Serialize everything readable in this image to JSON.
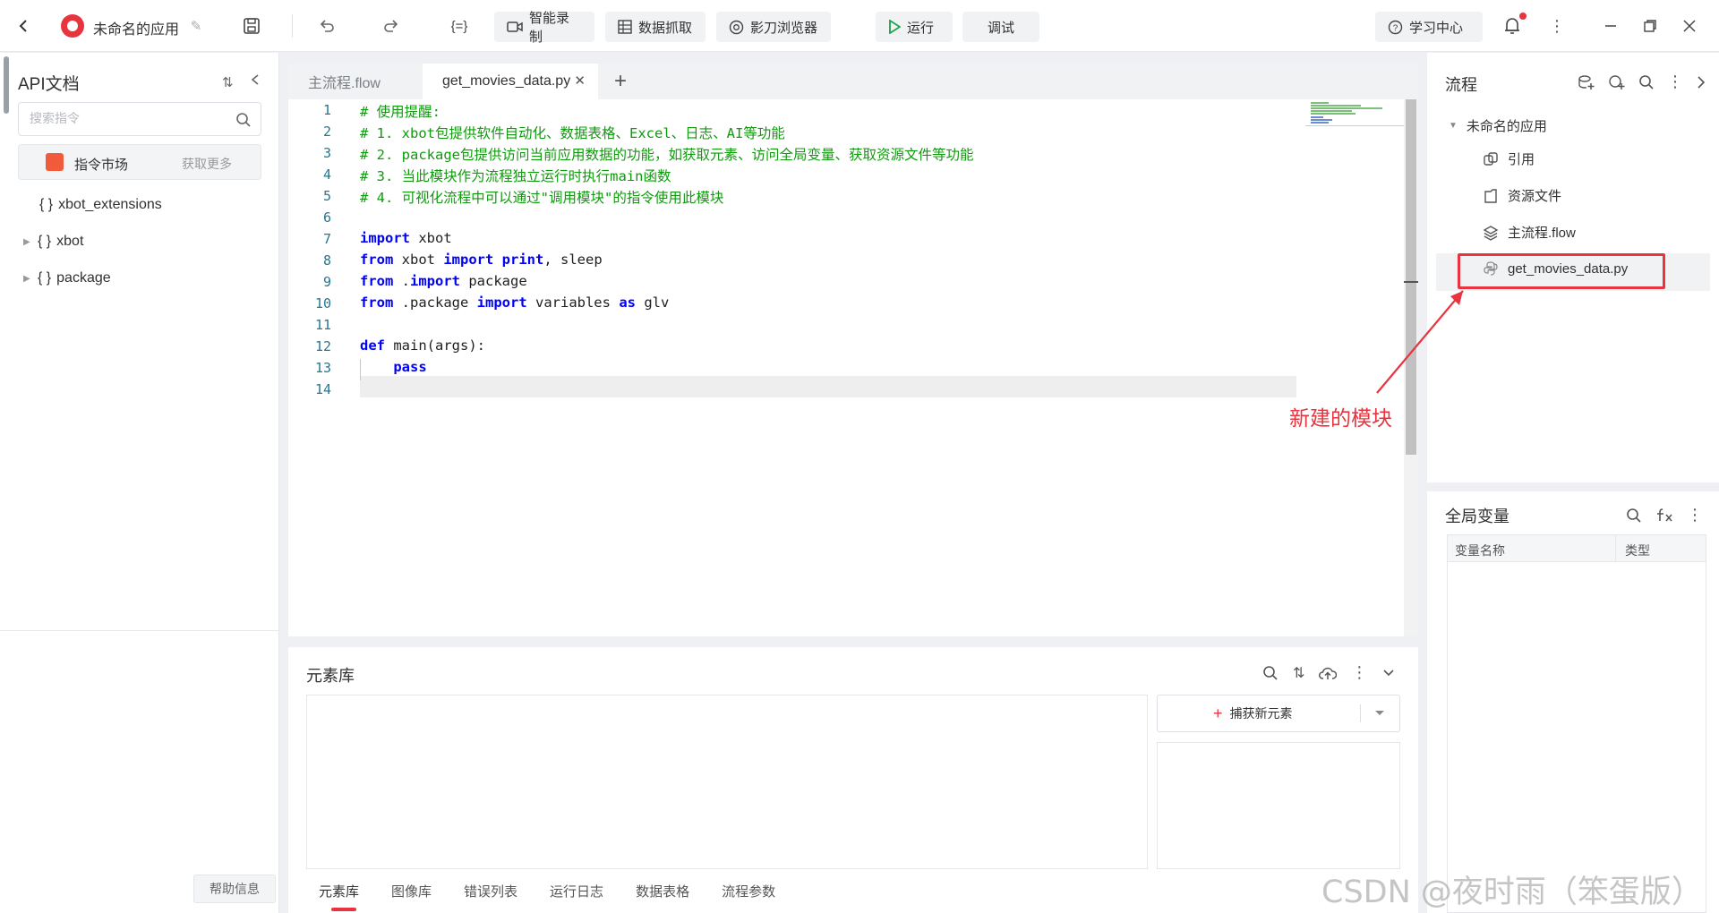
{
  "topbar": {
    "app_title": "未命名的应用",
    "braces_label": "{=}",
    "buttons": {
      "record": "智能录制",
      "scrape": "数据抓取",
      "browser": "影刀浏览器",
      "run": "运行",
      "debug": "调试",
      "learn": "学习中心"
    }
  },
  "left_panel": {
    "title": "API文档",
    "search_placeholder": "搜索指令",
    "market_label": "指令市场",
    "market_more": "获取更多",
    "tree": [
      "xbot_extensions",
      "xbot",
      "package"
    ],
    "help_label": "帮助信息"
  },
  "editor": {
    "tabs": [
      "主流程.flow",
      "get_movies_data.py"
    ],
    "line_numbers": [
      "1",
      "2",
      "3",
      "4",
      "5",
      "6",
      "7",
      "8",
      "9",
      "10",
      "11",
      "12",
      "13",
      "14"
    ],
    "comments": [
      "# 使用提醒:",
      "# 1. xbot包提供软件自动化、数据表格、Excel、日志、AI等功能",
      "# 2. package包提供访问当前应用数据的功能，如获取元素、访问全局变量、获取资源文件等功能",
      "# 3. 当此模块作为流程独立运行时执行main函数",
      "# 4. 可视化流程中可以通过\"调用模块\"的指令使用此模块"
    ],
    "code": {
      "kw_import": "import",
      "kw_from": "from",
      "kw_as": "as",
      "kw_def": "def",
      "kw_pass": "pass",
      "kw_print": "print",
      "l7_rest": " xbot",
      "l8_mid1": " xbot ",
      "l8_mid2": " ",
      "l8_rest": ", sleep",
      "l9_mid": " .",
      "l9_rest": " package",
      "l10_mid": " .package ",
      "l10_mid2": " variables ",
      "l10_rest": " glv",
      "l12_rest": " main(args):",
      "l13_indent": "    "
    }
  },
  "element_library": {
    "title": "元素库",
    "capture_label": "捕获新元素",
    "bottom_tabs": [
      "元素库",
      "图像库",
      "错误列表",
      "运行日志",
      "数据表格",
      "流程参数"
    ]
  },
  "right_panel": {
    "title": "流程",
    "root": "未命名的应用",
    "items": [
      "引用",
      "资源文件",
      "主流程.flow",
      "get_movies_data.py"
    ],
    "annotation": "新建的模块"
  },
  "global_vars": {
    "title": "全局变量",
    "columns": [
      "变量名称",
      "类型"
    ]
  },
  "watermark": "CSDN @夜时雨（笨蛋版）",
  "colors": {
    "accent": "#e8343f",
    "comment": "#109a0e",
    "keyword": "#0000ff"
  }
}
